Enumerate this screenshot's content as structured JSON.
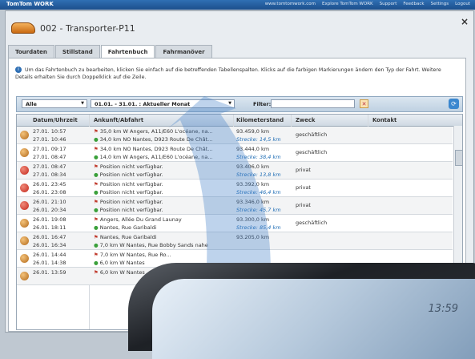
{
  "topbar": {
    "brand": "TomTom WORK",
    "links": [
      "www.tomtomwork.com",
      "Explore TomTom WORK",
      "Support",
      "Feedback",
      "Settings",
      "Logout"
    ]
  },
  "window": {
    "title": "002 - Transporter-P11",
    "close_symbol": "×"
  },
  "tabs": [
    "Tourdaten",
    "Stillstand",
    "Fahrtenbuch",
    "Fahrmanöver"
  ],
  "active_tab": "Fahrtenbuch",
  "info_text": "Um das Fahrtenbuch zu bearbeiten, klicken Sie einfach auf die betreffenden Tabellenspalten. Klicks auf die farbigen Markierungen ändern den Typ der Fahrt. Weitere Details erhalten Sie durch Doppelklick auf die Zeile.",
  "filters": {
    "type_value": "Alle",
    "period_value": "01.01. - 31.01. : Aktueller Monat",
    "filter_label": "Filter:",
    "filter_value": ""
  },
  "columns": [
    "Datum/Uhrzeit",
    "Ankunft/Abfahrt",
    "Kilometerstand",
    "Zweck",
    "Kontakt"
  ],
  "rows": [
    {
      "type": "biz",
      "date1": "27.01. 10:57",
      "date2": "27.01. 10:46",
      "arr": "35,0 km W Angers, A11/E60 L'océane, na...",
      "dep": "34,0 km NO Nantes, D923 Route De Chât...",
      "km": "93.459,0 km",
      "dist": "Strecke: 14,5 km",
      "purpose": "geschäftlich"
    },
    {
      "type": "biz",
      "date1": "27.01. 09:17",
      "date2": "27.01. 08:47",
      "arr": "34,0 km NO Nantes, D923 Route De Chât...",
      "dep": "14,0 km W Angers, A11/E60 L'océane, na...",
      "km": "93.444,0 km",
      "dist": "Strecke: 38,4 km",
      "purpose": "geschäftlich"
    },
    {
      "type": "priv",
      "date1": "27.01. 08:47",
      "date2": "27.01. 08:34",
      "arr": "Position nicht verfügbar.",
      "dep": "Position nicht verfügbar.",
      "km": "93.406,0 km",
      "dist": "Strecke: 13,8 km",
      "purpose": "privat"
    },
    {
      "type": "priv",
      "date1": "26.01. 23:45",
      "date2": "26.01. 23:08",
      "arr": "Position nicht verfügbar.",
      "dep": "Position nicht verfügbar.",
      "km": "93.392,0 km",
      "dist": "Strecke: 46,4 km",
      "purpose": "privat"
    },
    {
      "type": "priv",
      "date1": "26.01. 21:10",
      "date2": "26.01. 20:34",
      "arr": "Position nicht verfügbar.",
      "dep": "Position nicht verfügbar.",
      "km": "93.346,0 km",
      "dist": "Strecke: 45,7 km",
      "purpose": "privat"
    },
    {
      "type": "biz",
      "date1": "26.01. 19:08",
      "date2": "26.01. 18:11",
      "arr": "Angers, Allée Du Grand Launay",
      "dep": "Nantes, Rue Garibaldi",
      "km": "93.300,0 km",
      "dist": "Strecke: 85,4 km",
      "purpose": "geschäftlich"
    },
    {
      "type": "biz",
      "date1": "26.01. 16:47",
      "date2": "26.01. 16:34",
      "arr": "Nantes, Rue Garibaldi",
      "dep": "7,0 km W Nantes, Rue Bobby Sands nahe",
      "km": "93.205,0 km",
      "dist": "",
      "purpose": ""
    },
    {
      "type": "biz",
      "date1": "26.01. 14:44",
      "date2": "26.01. 14:38",
      "arr": "7,0 km W Nantes, Rue Ro...",
      "dep": "6,0 km W Nantes",
      "km": "",
      "dist": "",
      "purpose": ""
    },
    {
      "type": "biz",
      "date1": "26.01. 13:59",
      "date2": "",
      "arr": "6,0 km W Nantes",
      "dep": "",
      "km": "",
      "dist": "",
      "purpose": ""
    }
  ],
  "device": {
    "time": "13:59"
  },
  "colors": {
    "accent": "#2f6fb4",
    "business": "#c9781f",
    "private": "#c3271c",
    "distance_text": "#1f6db5"
  }
}
